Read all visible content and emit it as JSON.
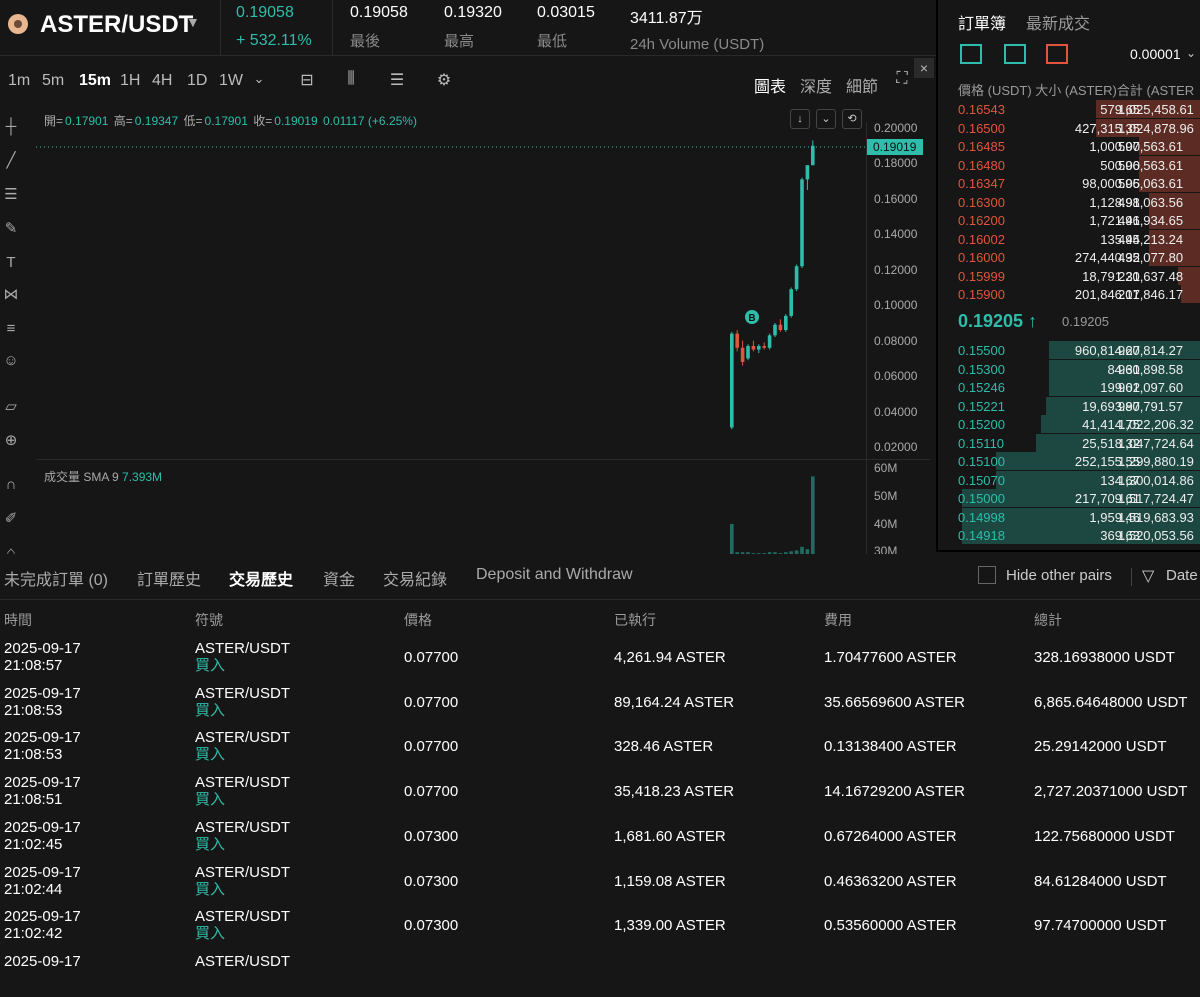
{
  "header": {
    "pair": "ASTER/USDT",
    "last_price": "0.19058",
    "change_pct": "+ 532.11%",
    "stats": [
      {
        "value": "0.19058",
        "label": "最後"
      },
      {
        "value": "0.19320",
        "label": "最高"
      },
      {
        "value": "0.03015",
        "label": "最低"
      },
      {
        "value": "3411.87万",
        "label": "24h Volume (USDT)"
      }
    ]
  },
  "toolbar": {
    "timeframes": [
      "1m",
      "5m",
      "15m",
      "1H",
      "4H",
      "1D",
      "1W"
    ],
    "active_timeframe": "15m",
    "views": [
      "圖表",
      "深度",
      "細節"
    ],
    "active_view": "圖表"
  },
  "chart": {
    "ohlc": {
      "open_label": "開=",
      "open": "0.17901",
      "high_label": "高=",
      "high": "0.19347",
      "low_label": "低=",
      "low": "0.17901",
      "close_label": "收=",
      "close": "0.19019",
      "change": "0.01117 (+6.25%)"
    },
    "price_tag": "0.19019",
    "volume_label": "成交量 SMA 9",
    "volume_value": "7.393M",
    "marker": "B"
  },
  "chart_data": {
    "type": "candlestick",
    "price_ticks": [
      "0.20000",
      "0.18000",
      "0.16000",
      "0.14000",
      "0.12000",
      "0.10000",
      "0.08000",
      "0.06000",
      "0.04000",
      "0.02000"
    ],
    "volume_ticks": [
      "60M",
      "50M",
      "40M",
      "30M"
    ],
    "ylim": [
      0.02,
      0.2
    ],
    "candles": [
      {
        "o": 0.031,
        "h": 0.085,
        "l": 0.03,
        "c": 0.084
      },
      {
        "o": 0.084,
        "h": 0.086,
        "l": 0.074,
        "c": 0.076
      },
      {
        "o": 0.076,
        "h": 0.08,
        "l": 0.066,
        "c": 0.068
      },
      {
        "o": 0.07,
        "h": 0.078,
        "l": 0.069,
        "c": 0.077
      },
      {
        "o": 0.077,
        "h": 0.08,
        "l": 0.074,
        "c": 0.075
      },
      {
        "o": 0.075,
        "h": 0.078,
        "l": 0.073,
        "c": 0.077
      },
      {
        "o": 0.077,
        "h": 0.079,
        "l": 0.075,
        "c": 0.076
      },
      {
        "o": 0.076,
        "h": 0.084,
        "l": 0.075,
        "c": 0.083
      },
      {
        "o": 0.083,
        "h": 0.09,
        "l": 0.082,
        "c": 0.089
      },
      {
        "o": 0.089,
        "h": 0.092,
        "l": 0.085,
        "c": 0.086
      },
      {
        "o": 0.086,
        "h": 0.095,
        "l": 0.085,
        "c": 0.094
      },
      {
        "o": 0.094,
        "h": 0.11,
        "l": 0.093,
        "c": 0.109
      },
      {
        "o": 0.109,
        "h": 0.123,
        "l": 0.108,
        "c": 0.122
      },
      {
        "o": 0.122,
        "h": 0.172,
        "l": 0.121,
        "c": 0.171
      },
      {
        "o": 0.171,
        "h": 0.179,
        "l": 0.165,
        "c": 0.179
      },
      {
        "o": 0.179,
        "h": 0.193,
        "l": 0.179,
        "c": 0.19
      }
    ],
    "volumes": [
      40,
      2,
      2,
      2,
      1,
      1,
      1,
      2,
      2,
      1,
      2,
      3,
      4,
      8,
      31,
      57
    ]
  },
  "orderbook": {
    "tabs": [
      "訂單簿",
      "最新成交"
    ],
    "precision": "0.00001",
    "headers": "價格 (USDT) 大小 (ASTER)合計 (ASTER",
    "asks": [
      {
        "price": "0.16543",
        "size": "579.65",
        "total": "1,025,458.61",
        "depth": 0.4
      },
      {
        "price": "0.16500",
        "size": "427,315.35",
        "total": "1,024,878.96",
        "depth": 0.4
      },
      {
        "price": "0.16485",
        "size": "1,000.00",
        "total": "597,563.61",
        "depth": 0.24
      },
      {
        "price": "0.16480",
        "size": "500.00",
        "total": "596,563.61",
        "depth": 0.24
      },
      {
        "price": "0.16347",
        "size": "98,000.05",
        "total": "596,063.61",
        "depth": 0.24
      },
      {
        "price": "0.16300",
        "size": "1,128.91",
        "total": "498,063.56",
        "depth": 0.2
      },
      {
        "price": "0.16200",
        "size": "1,721.41",
        "total": "496,934.65",
        "depth": 0.2
      },
      {
        "price": "0.16002",
        "size": "135.44",
        "total": "495,213.24",
        "depth": 0.2
      },
      {
        "price": "0.16000",
        "size": "274,440.32",
        "total": "495,077.80",
        "depth": 0.2
      },
      {
        "price": "0.15999",
        "size": "18,791.31",
        "total": "220,637.48",
        "depth": 0.09
      },
      {
        "price": "0.15900",
        "size": "201,846.17",
        "total": "201,846.17",
        "depth": 0.08
      }
    ],
    "mid_price": "0.19205",
    "mid_arrow": "↑",
    "mid_ref": "0.19205",
    "bids": [
      {
        "price": "0.15500",
        "size": "960,814.27",
        "total": "960,814.27",
        "depth": 0.58
      },
      {
        "price": "0.15300",
        "size": "84.31",
        "total": "960,898.58",
        "depth": 0.58
      },
      {
        "price": "0.15246",
        "size": "199.02",
        "total": "961,097.60",
        "depth": 0.58
      },
      {
        "price": "0.15221",
        "size": "19,693.97",
        "total": "980,791.57",
        "depth": 0.59
      },
      {
        "price": "0.15200",
        "size": "41,414.75",
        "total": "1,022,206.32",
        "depth": 0.61
      },
      {
        "price": "0.15110",
        "size": "25,518.32",
        "total": "1,047,724.64",
        "depth": 0.63
      },
      {
        "price": "0.15100",
        "size": "252,155.55",
        "total": "1,299,880.19",
        "depth": 0.78
      },
      {
        "price": "0.15070",
        "size": "134.67",
        "total": "1,300,014.86",
        "depth": 0.78
      },
      {
        "price": "0.15000",
        "size": "217,709.61",
        "total": "1,517,724.47",
        "depth": 0.91
      },
      {
        "price": "0.14998",
        "size": "1,959.46",
        "total": "1,519,683.93",
        "depth": 0.91
      },
      {
        "price": "0.14918",
        "size": "369.63",
        "total": "1,520,053.56",
        "depth": 0.91
      }
    ]
  },
  "orders": {
    "tabs": [
      "未完成訂單 (0)",
      "訂單歷史",
      "交易歷史",
      "資金",
      "交易紀錄",
      "Deposit and Withdraw"
    ],
    "active_tab": "交易歷史",
    "hide_other": "Hide other pairs",
    "date_label": "Date",
    "columns": [
      "時間",
      "符號",
      "價格",
      "已執行",
      "費用",
      "總計"
    ],
    "rows": [
      {
        "date": "2025-09-17",
        "time": "21:08:57",
        "symbol": "ASTER/USDT",
        "side": "買入",
        "price": "0.07700",
        "executed": "4,261.94 ASTER",
        "fee": "1.70477600 ASTER",
        "total": "328.16938000 USDT"
      },
      {
        "date": "2025-09-17",
        "time": "21:08:53",
        "symbol": "ASTER/USDT",
        "side": "買入",
        "price": "0.07700",
        "executed": "89,164.24 ASTER",
        "fee": "35.66569600 ASTER",
        "total": "6,865.64648000 USDT"
      },
      {
        "date": "2025-09-17",
        "time": "21:08:53",
        "symbol": "ASTER/USDT",
        "side": "買入",
        "price": "0.07700",
        "executed": "328.46 ASTER",
        "fee": "0.13138400 ASTER",
        "total": "25.29142000 USDT"
      },
      {
        "date": "2025-09-17",
        "time": "21:08:51",
        "symbol": "ASTER/USDT",
        "side": "買入",
        "price": "0.07700",
        "executed": "35,418.23 ASTER",
        "fee": "14.16729200 ASTER",
        "total": "2,727.20371000 USDT"
      },
      {
        "date": "2025-09-17",
        "time": "21:02:45",
        "symbol": "ASTER/USDT",
        "side": "買入",
        "price": "0.07300",
        "executed": "1,681.60 ASTER",
        "fee": "0.67264000 ASTER",
        "total": "122.75680000 USDT"
      },
      {
        "date": "2025-09-17",
        "time": "21:02:44",
        "symbol": "ASTER/USDT",
        "side": "買入",
        "price": "0.07300",
        "executed": "1,159.08 ASTER",
        "fee": "0.46363200 ASTER",
        "total": "84.61284000 USDT"
      },
      {
        "date": "2025-09-17",
        "time": "21:02:42",
        "symbol": "ASTER/USDT",
        "side": "買入",
        "price": "0.07300",
        "executed": "1,339.00 ASTER",
        "fee": "0.53560000 ASTER",
        "total": "97.74700000 USDT"
      },
      {
        "date": "2025-09-17",
        "time": "",
        "symbol": "ASTER/USDT",
        "side": "",
        "price": "",
        "executed": "",
        "fee": "",
        "total": ""
      }
    ]
  },
  "colors": {
    "up": "#2ebdaa",
    "down": "#e0553e",
    "background": "#161616"
  }
}
